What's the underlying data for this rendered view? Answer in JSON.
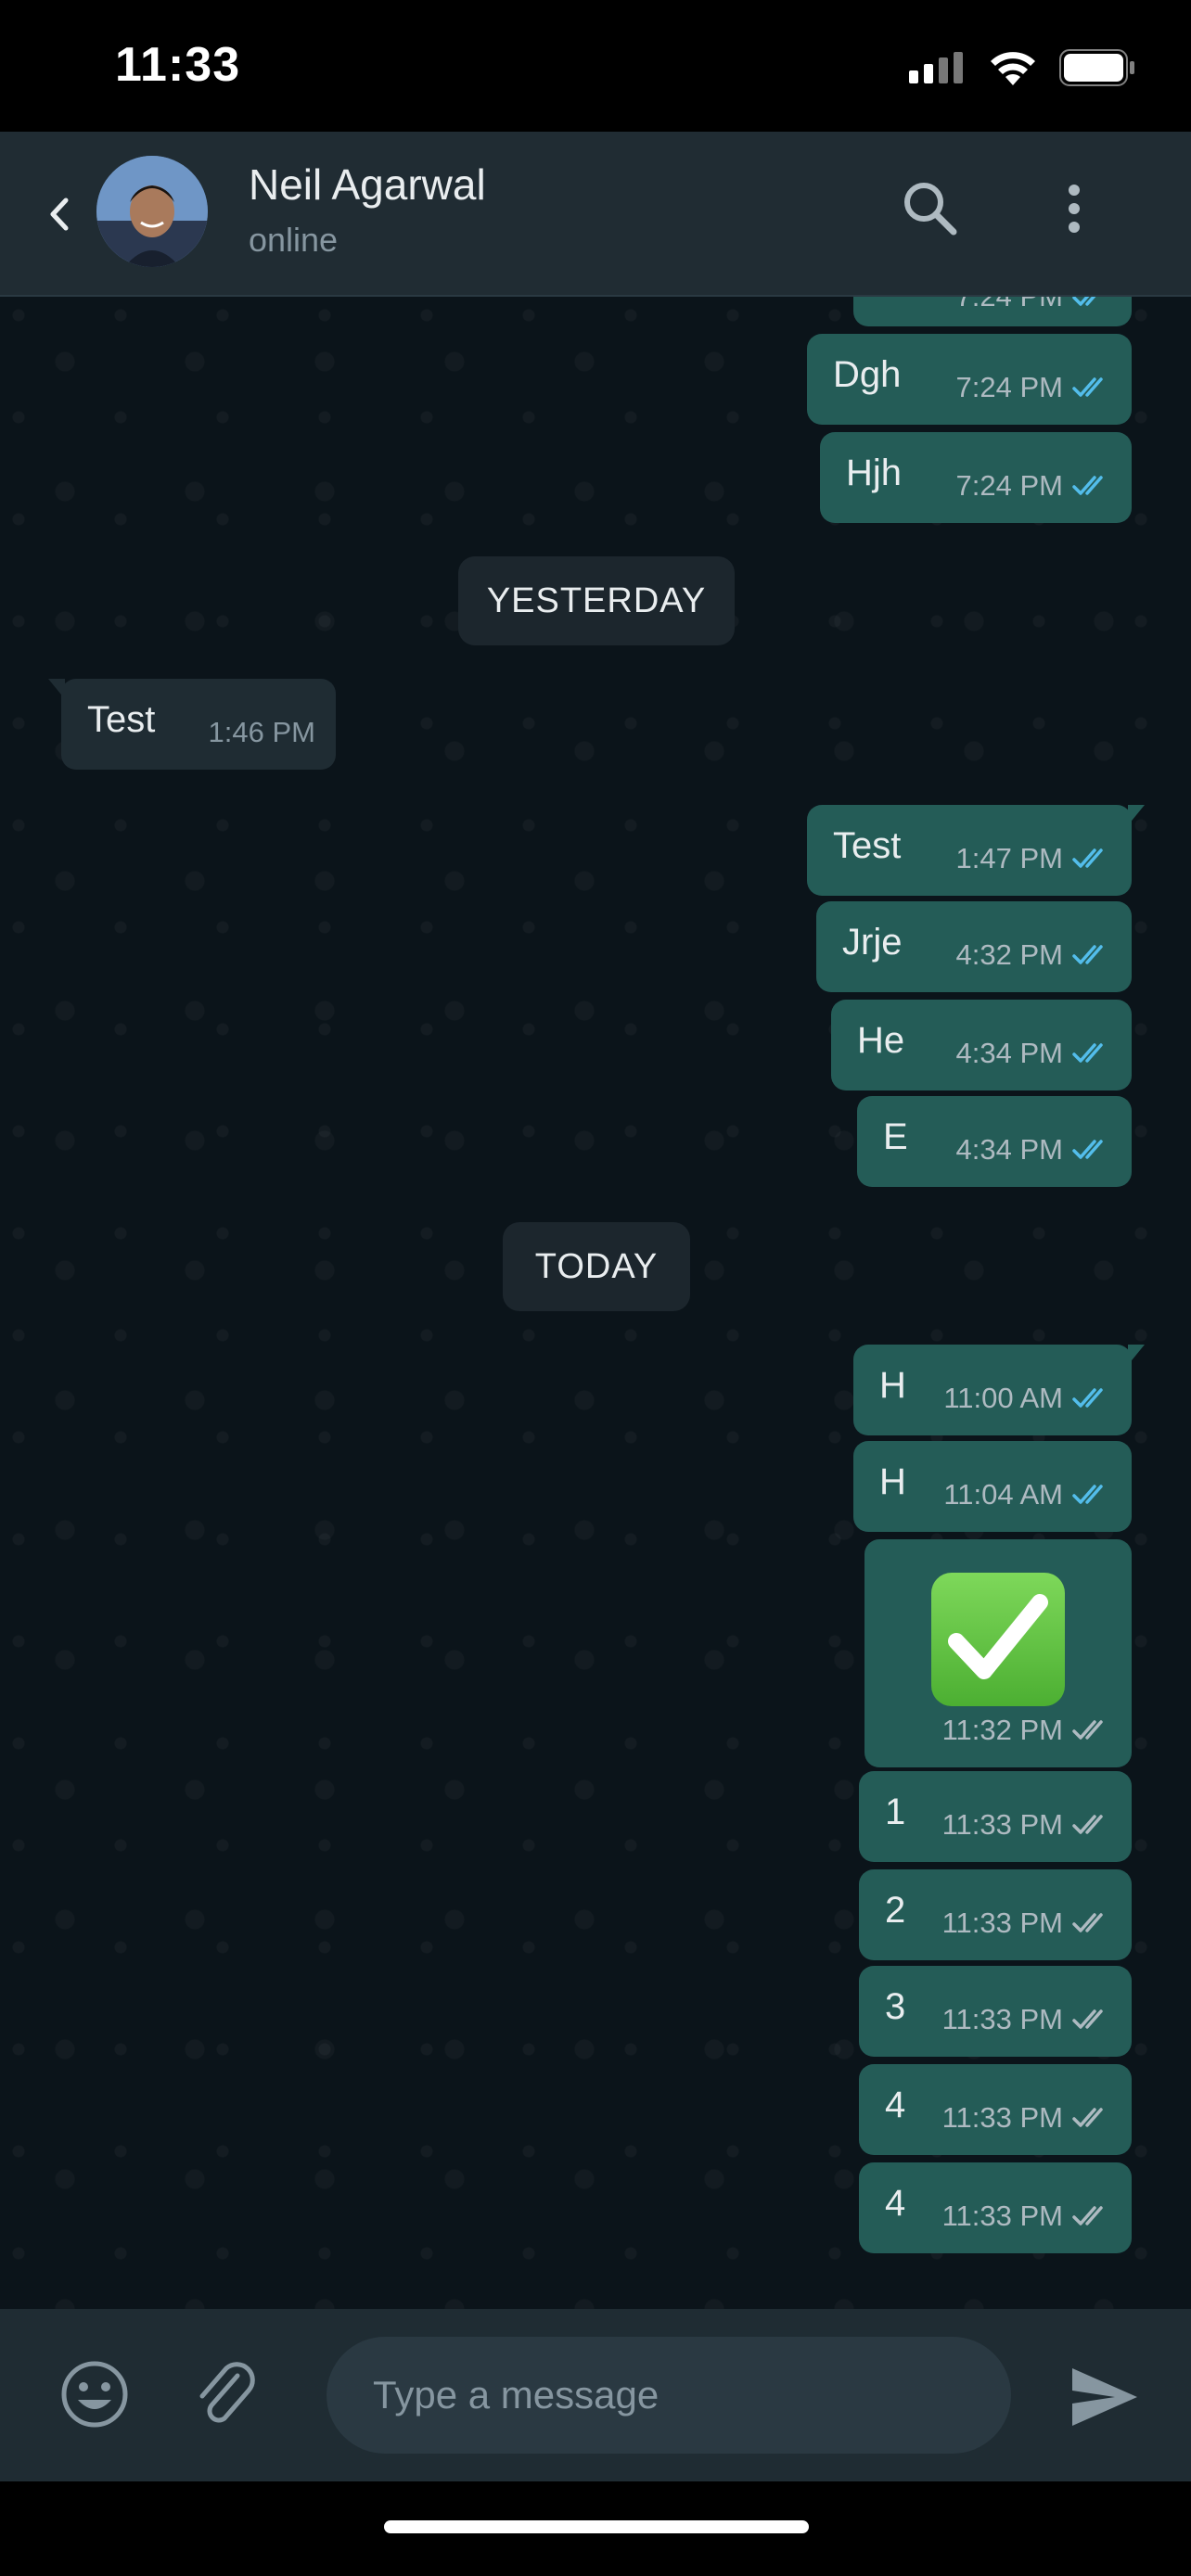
{
  "status_bar": {
    "time": "11:33",
    "icons": [
      "signal-icon",
      "wifi-icon",
      "battery-icon"
    ]
  },
  "header": {
    "contact_name": "Neil Agarwal",
    "contact_status": "online",
    "icons": [
      "back-chevron-icon",
      "avatar",
      "search-icon",
      "more-vert-icon"
    ]
  },
  "chat": {
    "partial_top_time": "7:24 PM",
    "messages_before": [
      {
        "text": "Dgh",
        "time": "7:24 PM",
        "ticks": "read"
      },
      {
        "text": "Hjh",
        "time": "7:24 PM",
        "ticks": "read"
      }
    ],
    "divider_yesterday": "YESTERDAY",
    "incoming": {
      "text": "Test",
      "time": "1:46 PM"
    },
    "messages_yesterday": [
      {
        "text": "Test",
        "time": "1:47 PM",
        "ticks": "read"
      },
      {
        "text": "Jrje",
        "time": "4:32 PM",
        "ticks": "read"
      },
      {
        "text": "He",
        "time": "4:34 PM",
        "ticks": "read"
      },
      {
        "text": "E",
        "time": "4:34 PM",
        "ticks": "read"
      }
    ],
    "divider_today": "TODAY",
    "messages_today": [
      {
        "text": "H",
        "time": "11:00 AM",
        "ticks": "read"
      },
      {
        "text": "H",
        "time": "11:04 AM",
        "ticks": "read"
      }
    ],
    "emoji_message": {
      "emoji": "check-mark-button-icon",
      "time": "11:32 PM",
      "ticks": "delivered"
    },
    "messages_latest": [
      {
        "text": "1",
        "time": "11:33 PM",
        "ticks": "delivered"
      },
      {
        "text": "2",
        "time": "11:33 PM",
        "ticks": "delivered"
      },
      {
        "text": "3",
        "time": "11:33 PM",
        "ticks": "delivered"
      },
      {
        "text": "4",
        "time": "11:33 PM",
        "ticks": "delivered"
      },
      {
        "text": "4",
        "time": "11:33 PM",
        "ticks": "delivered"
      }
    ]
  },
  "composer": {
    "placeholder": "Type a message",
    "icons": [
      "emoji-icon",
      "attach-icon",
      "send-icon"
    ]
  },
  "colors": {
    "read_tick": "#53bdeb",
    "delivered_tick": "#aebac1",
    "outgoing_bubble": "#245c57",
    "incoming_bubble": "#1f2c33",
    "header_bg": "#202c33",
    "chat_bg": "#0b141a"
  }
}
